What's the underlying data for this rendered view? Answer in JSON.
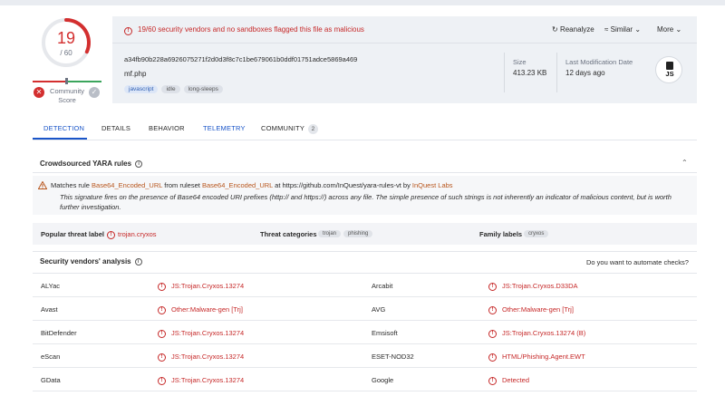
{
  "score": {
    "detected": "19",
    "total": "/ 60",
    "detected_count": 19,
    "total_count": 60,
    "color": "#d32f2f"
  },
  "community": {
    "label_line1": "Community",
    "label_line2": "Score"
  },
  "alert": {
    "text": "19/60 security vendors and no sandboxes flagged this file as malicious"
  },
  "actions": {
    "reanalyze": "Reanalyze",
    "similar": "Similar",
    "more": "More"
  },
  "file": {
    "hash": "a34fb90b228a6926075271f2d0d3f8c7c1be679061b0ddf01751adce5869a469",
    "name": "mf.php",
    "tags": [
      "javascript",
      "idle",
      "long-sleeps"
    ],
    "size_label": "Size",
    "size_value": "413.23 KB",
    "lastmod_label": "Last Modification Date",
    "lastmod_value": "12 days ago",
    "type_icon_label": "JS"
  },
  "tabs": [
    {
      "label": "DETECTION",
      "active": true
    },
    {
      "label": "DETAILS"
    },
    {
      "label": "BEHAVIOR"
    },
    {
      "label": "TELEMETRY"
    },
    {
      "label": "COMMUNITY",
      "badge": "2"
    }
  ],
  "yara": {
    "title": "Crowdsourced YARA rules",
    "rule_prefix": "Matches rule",
    "rule_name": "Base64_Encoded_URL",
    "from_text": "from ruleset",
    "ruleset": "Base64_Encoded_URL",
    "at_text": "at https://github.com/InQuest/yara-rules-vt by",
    "author": "InQuest Labs",
    "description": "This signature fires on the presence of Base64 encoded URI prefixes (http:// and https://) across any file. The simple presence of such strings is not inherently an indicator of malicious content, but is worth further investigation."
  },
  "threat": {
    "popular_label": "Popular threat label",
    "popular_value": "trojan.cryxos",
    "categories_label": "Threat categories",
    "categories": [
      "trojan",
      "phishing"
    ],
    "family_label": "Family labels",
    "family": [
      "cryxos"
    ]
  },
  "vendors": {
    "title": "Security vendors' analysis",
    "automate": "Do you want to automate checks?",
    "rows": [
      {
        "left_name": "ALYac",
        "left_result": "JS:Trojan.Cryxos.13274",
        "right_name": "Arcabit",
        "right_result": "JS:Trojan.Cryxos.D33DA"
      },
      {
        "left_name": "Avast",
        "left_result": "Other:Malware-gen [Trj]",
        "right_name": "AVG",
        "right_result": "Other:Malware-gen [Trj]"
      },
      {
        "left_name": "BitDefender",
        "left_result": "JS:Trojan.Cryxos.13274",
        "right_name": "Emsisoft",
        "right_result": "JS:Trojan.Cryxos.13274 (B)"
      },
      {
        "left_name": "eScan",
        "left_result": "JS:Trojan.Cryxos.13274",
        "right_name": "ESET-NOD32",
        "right_result": "HTML/Phishing.Agent.EWT"
      },
      {
        "left_name": "GData",
        "left_result": "JS:Trojan.Cryxos.13274",
        "right_name": "Google",
        "right_result": "Detected"
      }
    ]
  },
  "colors": {
    "accent": "#1a55c8",
    "danger": "#c62828",
    "ok": "#3ba55c"
  }
}
